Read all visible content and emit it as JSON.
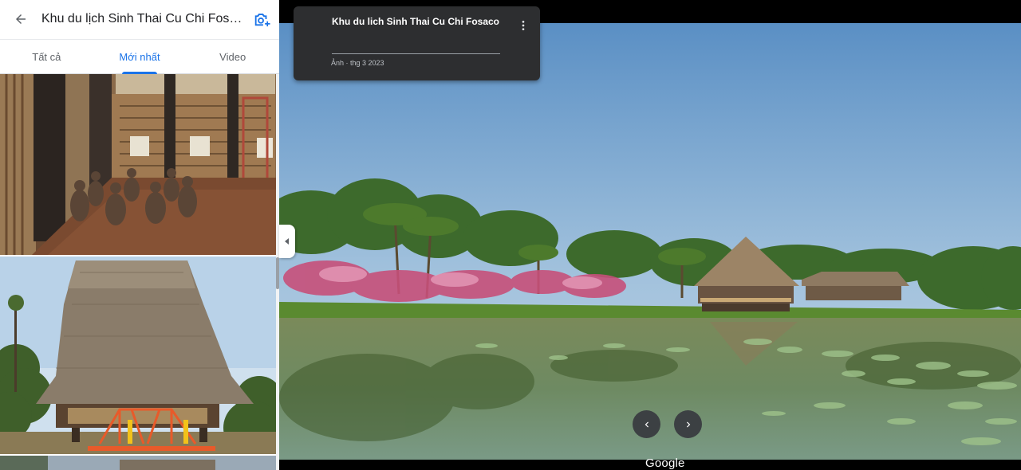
{
  "header": {
    "title": "Khu du lịch Sinh Thai Cu Chi Fosaco",
    "back_icon": "arrow-left-icon",
    "add_photo_icon": "add-photo-icon"
  },
  "tabs": [
    {
      "label": "Tất cả",
      "active": false
    },
    {
      "label": "Mới nhất",
      "active": true
    },
    {
      "label": "Video",
      "active": false
    }
  ],
  "thumbnails": [
    {
      "name": "longhouse-interior-statues"
    },
    {
      "name": "thatched-communal-house"
    },
    {
      "name": "next-photo-partial"
    }
  ],
  "viewer": {
    "card_title": "Khu du lich Sinh Thai Cu Chi Fosaco",
    "card_date": "Ảnh · thg 3 2023",
    "more_icon": "more-vert-icon",
    "prev_icon": "chevron-left-icon",
    "next_icon": "chevron-right-icon",
    "logo": "Google"
  },
  "colors": {
    "accent": "#1a73e8",
    "card_bg": "#2d2e30",
    "nav_btn": "#3c4043"
  }
}
